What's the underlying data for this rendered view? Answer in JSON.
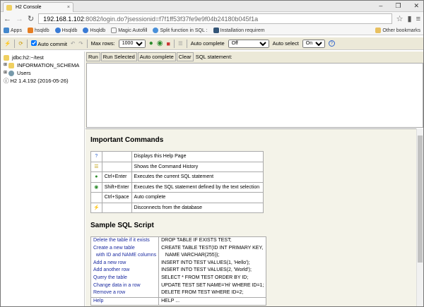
{
  "browser": {
    "tab_title": "H2 Console",
    "url_host": "192.168.1.102",
    "url_rest": ":8082/login.do?jsessionid=f7f1ff53f37fe9e9f04b24180b045f1a",
    "bookmarks": [
      "Apps",
      "hsqldb",
      "Hsqldb",
      "Hsqldb",
      "Magic Autofill",
      "Split function in SQL :",
      "Installation requirem"
    ],
    "other_bookmarks": "Other bookmarks"
  },
  "toolbar": {
    "auto_commit": "Auto commit",
    "max_rows_label": "Max rows:",
    "max_rows": "1000",
    "auto_complete_label": "Auto complete",
    "auto_complete": "Off",
    "auto_select_label": "Auto select",
    "auto_select": "On"
  },
  "tree": {
    "connection": "jdbc:h2:~/test",
    "schema": "INFORMATION_SCHEMA",
    "users": "Users",
    "version": "H2 1.4.192 (2016-05-26)"
  },
  "query": {
    "run": "Run",
    "run_selected": "Run Selected",
    "auto_complete": "Auto complete",
    "clear": "Clear",
    "label": "SQL statement:"
  },
  "help": {
    "title": "Important Commands",
    "commands": [
      {
        "icon": "help-icon",
        "key": "",
        "desc": "Displays this Help Page"
      },
      {
        "icon": "history-icon",
        "key": "",
        "desc": "Shows the Command History"
      },
      {
        "icon": "run-icon",
        "key": "Ctrl+Enter",
        "desc": "Executes the current SQL statement"
      },
      {
        "icon": "run-selected-icon",
        "key": "Shift+Enter",
        "desc": "Executes the SQL statement defined by the text selection"
      },
      {
        "icon": "",
        "key": "Ctrl+Space",
        "desc": "Auto complete"
      },
      {
        "icon": "disconnect-icon",
        "key": "",
        "desc": "Disconnects from the database"
      }
    ],
    "sample_title": "Sample SQL Script",
    "sample": [
      {
        "a": "Delete the table if it exists",
        "b": "DROP TABLE IF EXISTS TEST;"
      },
      {
        "a": "Create a new table",
        "b": "CREATE TABLE TEST(ID INT PRIMARY KEY,"
      },
      {
        "a": "  with ID and NAME columns",
        "b": "   NAME VARCHAR(255));"
      },
      {
        "a": "Add a new row",
        "b": "INSERT INTO TEST VALUES(1, 'Hello');"
      },
      {
        "a": "Add another row",
        "b": "INSERT INTO TEST VALUES(2, 'World');"
      },
      {
        "a": "Query the table",
        "b": "SELECT * FROM TEST ORDER BY ID;"
      },
      {
        "a": "Change data in a row",
        "b": "UPDATE TEST SET NAME='Hi' WHERE ID=1;"
      },
      {
        "a": "Remove a row",
        "b": "DELETE FROM TEST WHERE ID=2;"
      },
      {
        "a": "Help",
        "b": "HELP ..."
      }
    ]
  }
}
